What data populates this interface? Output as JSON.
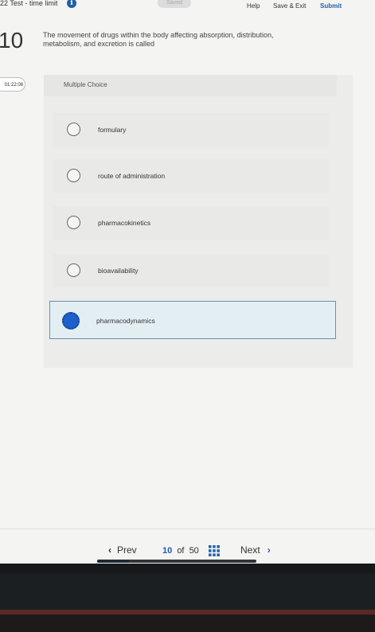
{
  "header": {
    "title": "22 Test - time limit",
    "info_icon": "info-icon",
    "saved_label": "Saved",
    "help_label": "Help",
    "save_exit_label": "Save & Exit",
    "submit_label": "Submit"
  },
  "question": {
    "number": "10",
    "text": "The movement of drugs within the body affecting absorption, distribution, metabolism, and excretion is called",
    "timer": "01:22:08",
    "type_label": "Multiple Choice"
  },
  "options": [
    {
      "label": "formulary",
      "selected": false
    },
    {
      "label": "route of administration",
      "selected": false
    },
    {
      "label": "pharmacokinetics",
      "selected": false
    },
    {
      "label": "bioavailability",
      "selected": false
    },
    {
      "label": "pharmacodynamics",
      "selected": true
    }
  ],
  "footer": {
    "prev_label": "Prev",
    "next_label": "Next",
    "current_page": "10",
    "of_label": "of",
    "total_pages": "50",
    "progress_fraction": 0.2,
    "grid_icon": "grid-icon"
  },
  "colors": {
    "accent": "#1f5fa8",
    "selected_fill": "#1d5fcc",
    "selected_bg": "#e3eef3"
  }
}
